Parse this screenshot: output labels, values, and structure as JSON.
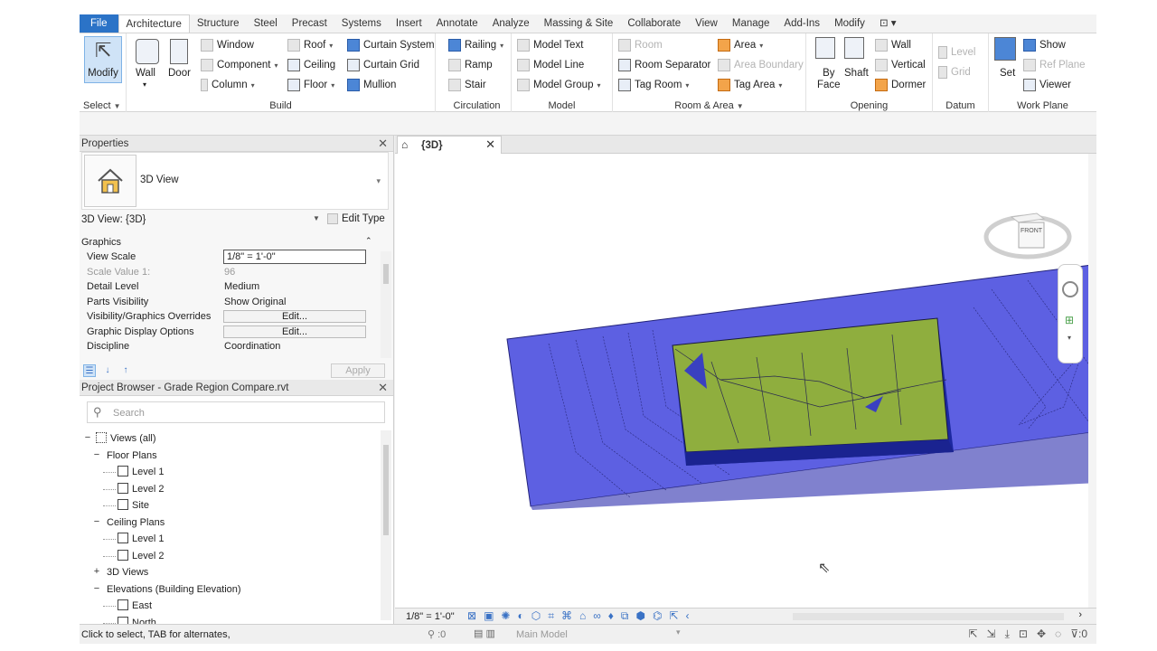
{
  "tabs": [
    "File",
    "Architecture",
    "Structure",
    "Steel",
    "Precast",
    "Systems",
    "Insert",
    "Annotate",
    "Analyze",
    "Massing & Site",
    "Collaborate",
    "View",
    "Manage",
    "Add-Ins",
    "Modify"
  ],
  "active_tab": "Architecture",
  "ribbon": {
    "select": {
      "modify": "Modify",
      "title": "Select"
    },
    "build": {
      "title": "Build",
      "wall": "Wall",
      "door": "Door",
      "window": "Window",
      "component": "Component",
      "column": "Column",
      "roof": "Roof",
      "ceiling": "Ceiling",
      "floor": "Floor",
      "curtain_system": "Curtain System",
      "curtain_grid": "Curtain Grid",
      "mullion": "Mullion"
    },
    "circulation": {
      "title": "Circulation",
      "railing": "Railing",
      "ramp": "Ramp",
      "stair": "Stair"
    },
    "model": {
      "title": "Model",
      "model_text": "Model Text",
      "model_line": "Model Line",
      "model_group": "Model Group"
    },
    "room_area": {
      "title": "Room & Area",
      "room": "Room",
      "room_separator": "Room Separator",
      "tag_room": "Tag Room",
      "area": "Area",
      "area_boundary": "Area Boundary",
      "tag_area": "Tag Area"
    },
    "opening": {
      "title": "Opening",
      "by_face_1": "By",
      "by_face_2": "Face",
      "shaft": "Shaft",
      "wall": "Wall",
      "vertical": "Vertical",
      "dormer": "Dormer"
    },
    "datum": {
      "title": "Datum",
      "level": "Level",
      "grid": "Grid"
    },
    "work_plane": {
      "title": "Work Plane",
      "set": "Set",
      "show": "Show",
      "ref_plane": "Ref Plane",
      "viewer": "Viewer"
    }
  },
  "properties": {
    "title": "Properties",
    "type_name": "3D View",
    "instance": "3D View: {3D}",
    "edit_type": "Edit Type",
    "group": "Graphics",
    "rows": [
      {
        "key": "View Scale",
        "value": "1/8\" = 1'-0\"",
        "kind": "box"
      },
      {
        "key": "Scale Value    1:",
        "value": "96",
        "kind": "disabled"
      },
      {
        "key": "Detail Level",
        "value": "Medium",
        "kind": "text"
      },
      {
        "key": "Parts Visibility",
        "value": "Show Original",
        "kind": "text"
      },
      {
        "key": "Visibility/Graphics Overrides",
        "value": "Edit...",
        "kind": "button"
      },
      {
        "key": "Graphic Display Options",
        "value": "Edit...",
        "kind": "button"
      },
      {
        "key": "Discipline",
        "value": "Coordination",
        "kind": "text"
      }
    ],
    "apply": "Apply"
  },
  "browser": {
    "title": "Project Browser - Grade Region Compare.rvt",
    "search_placeholder": "Search",
    "tree": [
      {
        "label": "Views (all)",
        "level": 0,
        "exp": "−",
        "icon": "views"
      },
      {
        "label": "Floor Plans",
        "level": 1,
        "exp": "−"
      },
      {
        "label": "Level 1",
        "level": 2,
        "icon": "view"
      },
      {
        "label": "Level 2",
        "level": 2,
        "icon": "view"
      },
      {
        "label": "Site",
        "level": 2,
        "icon": "view"
      },
      {
        "label": "Ceiling Plans",
        "level": 1,
        "exp": "−"
      },
      {
        "label": "Level 1",
        "level": 2,
        "icon": "view"
      },
      {
        "label": "Level 2",
        "level": 2,
        "icon": "view"
      },
      {
        "label": "3D Views",
        "level": 1,
        "exp": "+"
      },
      {
        "label": "Elevations (Building Elevation)",
        "level": 1,
        "exp": "−"
      },
      {
        "label": "East",
        "level": 2,
        "icon": "view"
      },
      {
        "label": "North",
        "level": 2,
        "icon": "view"
      }
    ]
  },
  "view": {
    "tab": "{3D}",
    "scale": "1/8\" = 1'-0\"",
    "cube_face": "FRONT"
  },
  "status": {
    "message": "Click to select, TAB for alternates,",
    "worksets": ":0",
    "model": "Main Model",
    "filter": ":0"
  },
  "colors": {
    "accent": "#2b73c7",
    "site": "#5c5fe0",
    "building_top": "#8fae3e",
    "building_side": "#1c2a9a"
  }
}
